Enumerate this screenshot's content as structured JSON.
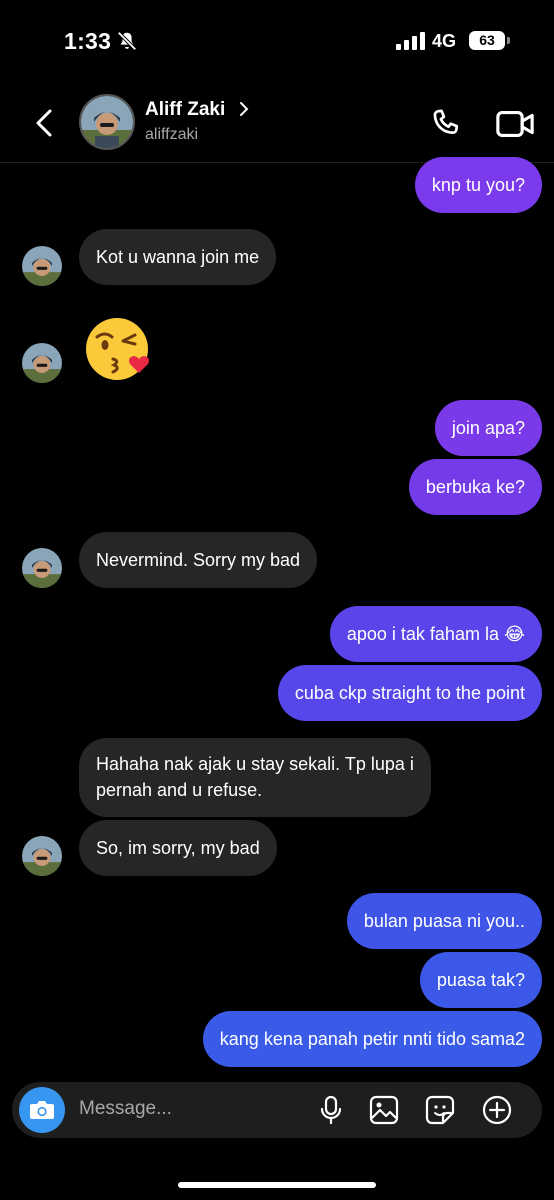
{
  "status_bar": {
    "time": "1:33",
    "network": "4G",
    "battery": "63"
  },
  "header": {
    "name": "Aliff Zaki",
    "username": "aliffzaki"
  },
  "messages": [
    {
      "text": "knp tu you?"
    },
    {
      "text": "Kot u wanna join me"
    },
    {
      "text": "😘"
    },
    {
      "text": "join apa?"
    },
    {
      "text": "berbuka ke?"
    },
    {
      "text": "Nevermind. Sorry my bad"
    },
    {
      "text": "apoo i tak faham la 😂"
    },
    {
      "text": "cuba ckp straight to the point"
    },
    {
      "line1": "Hahaha nak ajak u stay sekali. Tp lupa i",
      "line2": "pernah and u refuse."
    },
    {
      "text": "So, im sorry, my bad"
    },
    {
      "text": "bulan puasa ni you.."
    },
    {
      "text": "puasa tak?"
    },
    {
      "text": "kang kena panah petir nnti tido sama2"
    }
  ],
  "composer": {
    "placeholder": "Message..."
  },
  "colors": {
    "incoming_bubble": "#262626",
    "outgoing_purple": "#7c3aed",
    "outgoing_blue": "#3a5ae8",
    "camera_button": "#3797f0"
  }
}
